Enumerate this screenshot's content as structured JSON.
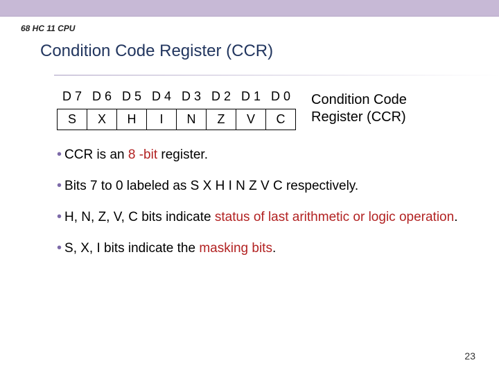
{
  "header_label": "68 HC 11 CPU",
  "title": "Condition Code Register (CCR)",
  "register": {
    "bit_labels": [
      "D 7",
      "D 6",
      "D 5",
      "D 4",
      "D 3",
      "D 2",
      "D 1",
      "D 0"
    ],
    "bit_names": [
      "S",
      "X",
      "H",
      "I",
      "N",
      "Z",
      "V",
      "C"
    ],
    "caption_line1": "Condition Code",
    "caption_line2": "Register (CCR)"
  },
  "bullets": {
    "b1_a": "CCR is an ",
    "b1_hl": "8 -bit",
    "b1_b": " register.",
    "b2": "Bits 7 to 0  labeled as  S X H I N Z V C  respectively.",
    "b3_a": "H, N, Z, V, C  bits indicate ",
    "b3_hl": "status of last arithmetic or logic operation",
    "b3_b": ".",
    "b4_a": "S, X, I  bits indicate the ",
    "b4_hl": "masking bits",
    "b4_b": "."
  },
  "page_number": "23"
}
